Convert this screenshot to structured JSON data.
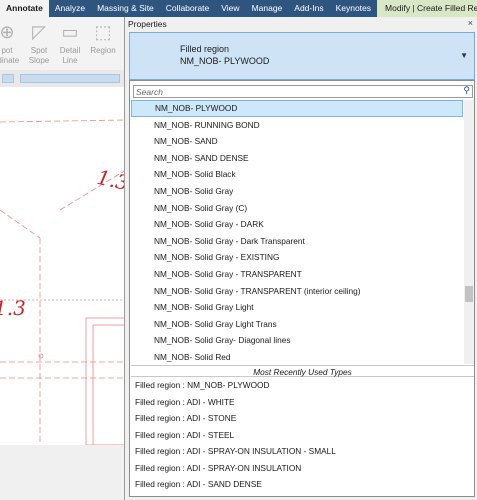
{
  "ribbon": {
    "tabs": [
      {
        "label": "Annotate"
      },
      {
        "label": "Analyze"
      },
      {
        "label": "Massing & Site"
      },
      {
        "label": "Collaborate"
      },
      {
        "label": "View"
      },
      {
        "label": "Manage"
      },
      {
        "label": "Add-Ins"
      },
      {
        "label": "Keynotes"
      },
      {
        "label": "Modify | Create Filled Re"
      }
    ],
    "tools": [
      {
        "line1": "pot",
        "line2": "rdinate"
      },
      {
        "line1": "Spot",
        "line2": "Slope"
      },
      {
        "line1": "Detail",
        "line2": "Line"
      },
      {
        "line1": "Region",
        "line2": ""
      }
    ]
  },
  "canvas": {
    "dim_labels": [
      "1.3",
      "1.3"
    ]
  },
  "properties": {
    "title": "Properties",
    "close_glyph": "×",
    "type_selector": {
      "family": "Filled region",
      "name": "NM_NOB- PLYWOOD",
      "chevron": "▼"
    },
    "search": {
      "placeholder": "Search",
      "icon": "search-icon"
    },
    "types": [
      "NM_NOB- PLYWOOD",
      "NM_NOB- RUNNING BOND",
      "NM_NOB- SAND",
      "NM_NOB- SAND DENSE",
      "NM_NOB- Solid Black",
      "NM_NOB- Solid Gray",
      "NM_NOB- Solid Gray (C)",
      "NM_NOB- Solid Gray - DARK",
      "NM_NOB- Solid Gray - Dark Transparent",
      "NM_NOB- Solid Gray - EXISTING",
      "NM_NOB- Solid Gray - TRANSPARENT",
      "NM_NOB- Solid Gray - TRANSPARENT (interior ceiling)",
      "NM_NOB- Solid Gray Light",
      "NM_NOB- Solid Gray Light Trans",
      "NM_NOB- Solid Gray- Diagonal lines",
      "NM_NOB- Solid Red"
    ],
    "selected_type": "NM_NOB- PLYWOOD",
    "mru_header": "Most Recently Used Types",
    "mru": [
      "Filled region : NM_NOB- PLYWOOD",
      "Filled region : ADI - WHITE",
      "Filled region : ADI - STONE",
      "Filled region : ADI - STEEL",
      "Filled region : ADI - SPRAY-ON INSULATION - SMALL",
      "Filled region : ADI - SPRAY-ON INSULATION",
      "Filled region : ADI - SAND DENSE"
    ]
  },
  "colors": {
    "ribbon_bg": "#2e5580",
    "selector_bg": "#cfe3f6",
    "selected_row": "#cde8f9",
    "drawing_red": "#c0282c"
  }
}
